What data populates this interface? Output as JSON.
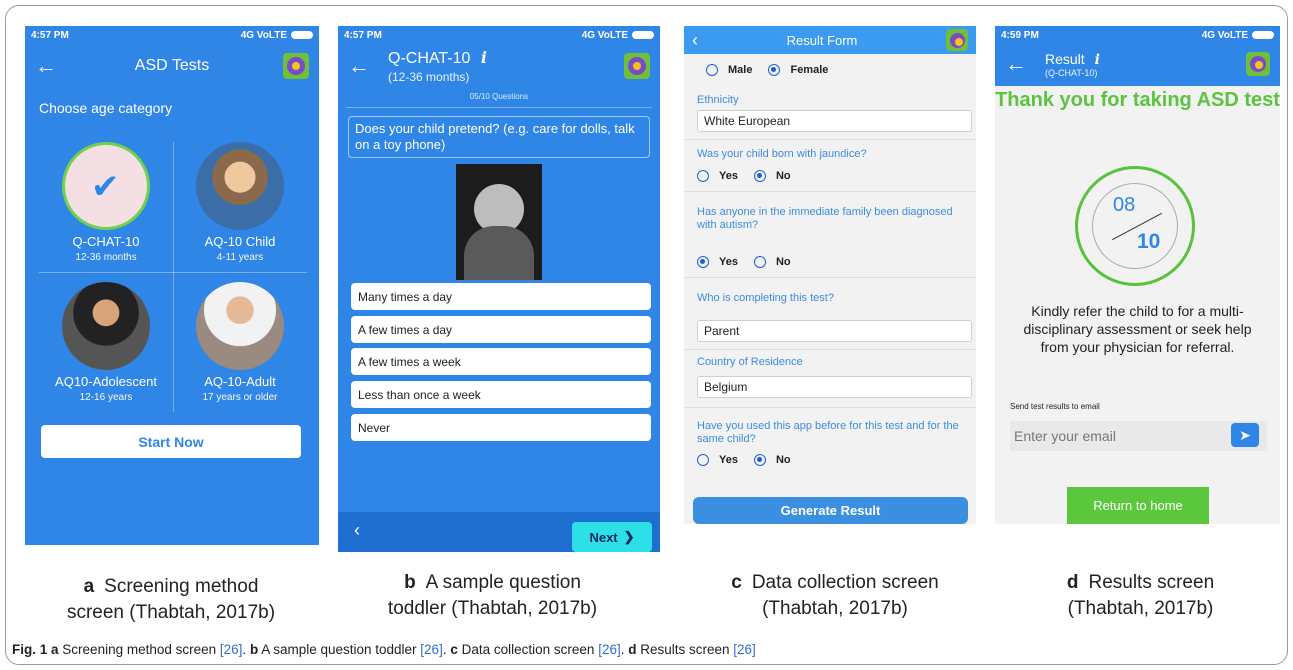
{
  "status": {
    "time_a": "4:57 PM",
    "time_b": "4:57 PM",
    "time_d": "4:59 PM",
    "network": "4G VoLTE"
  },
  "screen_a": {
    "title": "ASD Tests",
    "choose_label": "Choose age category",
    "categories": [
      {
        "name": "Q-CHAT-10",
        "age": "12-36 months",
        "selected": true
      },
      {
        "name": "AQ-10 Child",
        "age": "4-11 years",
        "selected": false
      },
      {
        "name": "AQ10-Adolescent",
        "age": "12-16 years",
        "selected": false
      },
      {
        "name": "AQ-10-Adult",
        "age": "17 years or older",
        "selected": false
      }
    ],
    "start_label": "Start Now"
  },
  "screen_b": {
    "title": "Q-CHAT-10",
    "subtitle": "(12-36 months)",
    "counter": "05/10 Questions",
    "question": "Does your child pretend? (e.g. care for dolls, talk on a toy phone)",
    "options": [
      "Many times a day",
      "A few times a day",
      "A few times a week",
      "Less than once a week",
      "Never"
    ],
    "next_label": "Next"
  },
  "screen_c": {
    "title": "Result Form",
    "gender": {
      "male": "Male",
      "female": "Female",
      "selected": "Female"
    },
    "ethnicity_label": "Ethnicity",
    "ethnicity_value": "White European",
    "jaundice_label": "Was your child born with jaundice?",
    "jaundice_selected": "No",
    "family_label": "Has anyone in the immediate family been diagnosed with autism?",
    "family_selected": "Yes",
    "completer_label": "Who is completing this test?",
    "completer_value": "Parent",
    "country_label": "Country of Residence",
    "country_value": "Belgium",
    "used_before_label": "Have you used this app before for this test and for the same child?",
    "used_before_selected": "No",
    "yes": "Yes",
    "no": "No",
    "generate_label": "Generate Result"
  },
  "screen_d": {
    "title": "Result",
    "subtitle": "(Q-CHAT-10)",
    "thank_you": "Thank you for taking ASD test",
    "score": "08",
    "total": "10",
    "message": "Kindly refer the child to for a multi-disciplinary assessment or seek help from your physician for referral.",
    "send_label": "Send test results to email",
    "email_placeholder": "Enter your email",
    "return_label": "Return to home"
  },
  "captions": {
    "a_letter": "a",
    "a_text": "Screening method",
    "a_text2": "screen (Thabtah, 2017b)",
    "b_letter": "b",
    "b_text": "A sample question",
    "b_text2": "toddler (Thabtah, 2017b)",
    "c_letter": "c",
    "c_text": "Data collection screen",
    "c_text2": "(Thabtah, 2017b)",
    "d_letter": "d",
    "d_text": "Results screen",
    "d_text2": "(Thabtah, 2017b)"
  },
  "figure_caption": {
    "fig": "Fig. 1",
    "a": "a",
    "a_text": " Screening method screen ",
    "b": "b",
    "b_text": " A sample question toddler ",
    "c": "c",
    "c_text": " Data collection screen ",
    "d": "d",
    "d_text": " Results screen ",
    "ref": "[26]"
  }
}
